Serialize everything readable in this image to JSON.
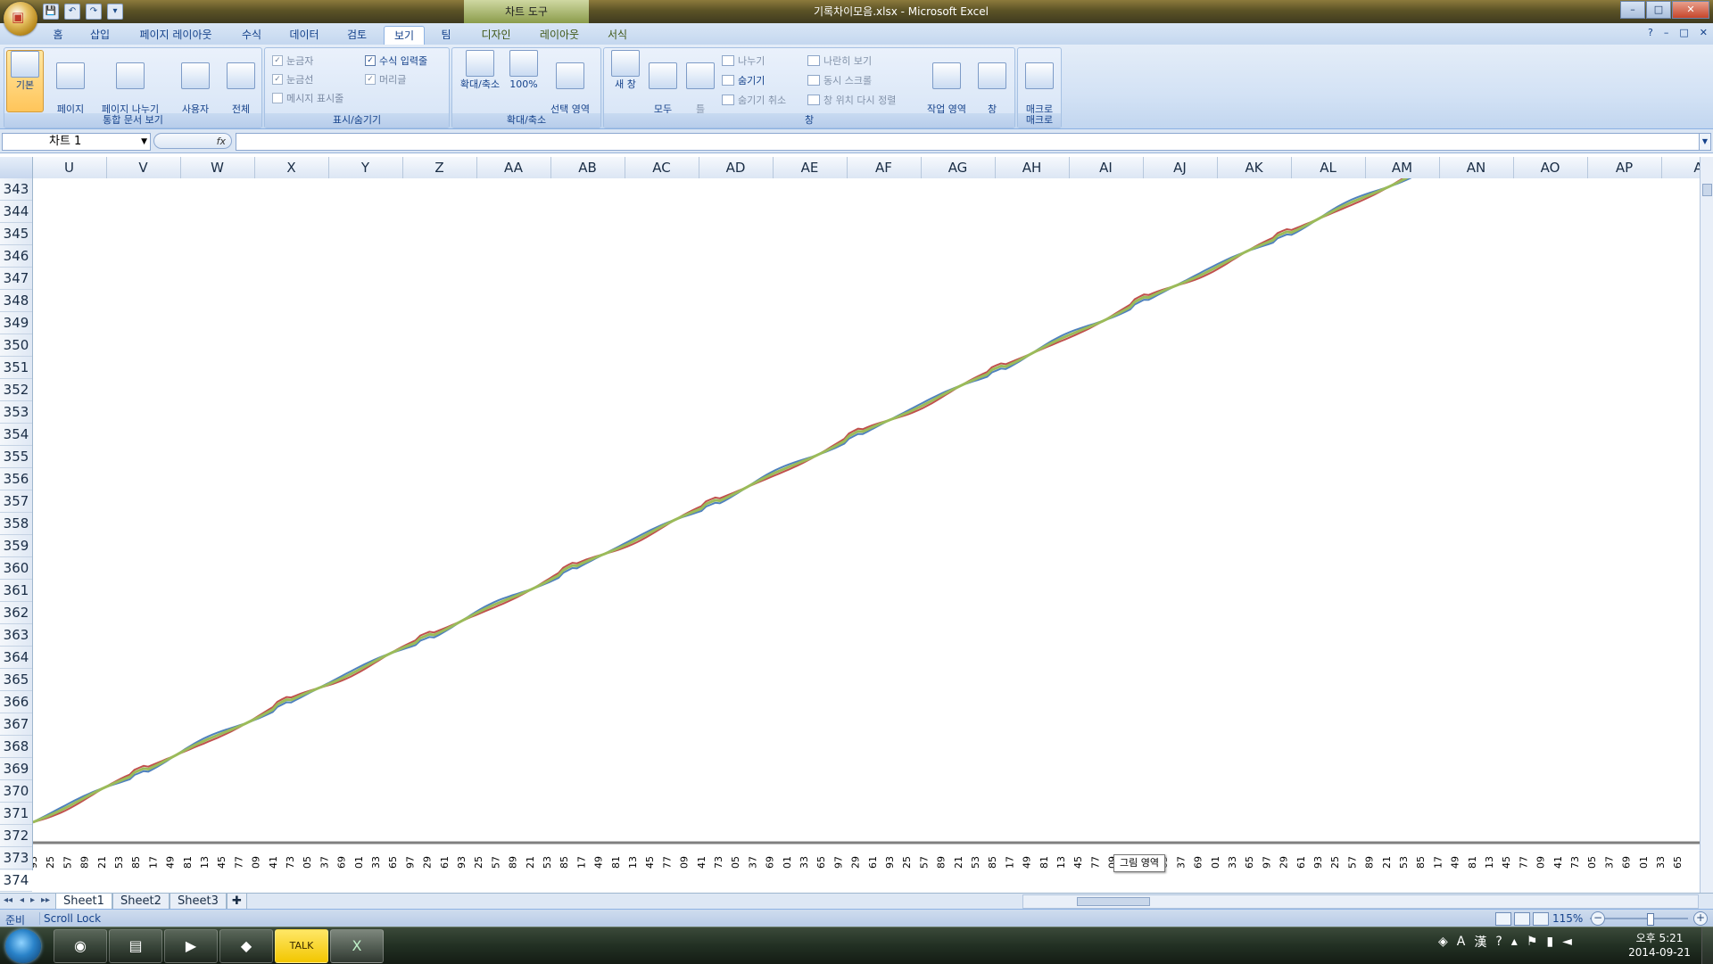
{
  "window": {
    "title": "기록차이모음.xlsx - Microsoft Excel",
    "context_tab_group": "차트 도구",
    "controls": [
      "–",
      "□",
      "✕"
    ]
  },
  "qat": {
    "save": "💾",
    "undo": "↶",
    "redo": "↷",
    "custom": "▾"
  },
  "ribbon_tabs": [
    {
      "label": "홈"
    },
    {
      "label": "삽입"
    },
    {
      "label": "페이지 레이아웃"
    },
    {
      "label": "수식"
    },
    {
      "label": "데이터"
    },
    {
      "label": "검토"
    },
    {
      "label": "보기",
      "active": true
    },
    {
      "label": "팀"
    },
    {
      "label": "디자인",
      "context": true
    },
    {
      "label": "레이아웃",
      "context": true
    },
    {
      "label": "서식",
      "context": true
    }
  ],
  "ribbon": {
    "workbook_views": {
      "label": "통합 문서 보기",
      "normal": "기본",
      "page_layout": "페이지\n레이아웃",
      "page_break": "페이지 나누기\n미리 보기",
      "custom_views": "사용자\n지정 보기",
      "full_screen": "전체\n화면"
    },
    "show_hide": {
      "label": "표시/숨기기",
      "ruler": "눈금자",
      "gridlines": "눈금선",
      "message_bar": "메시지 표시줄",
      "formula_bar": "수식 입력줄",
      "headings": "머리글"
    },
    "zoom": {
      "label": "확대/축소",
      "zoom": "확대/축소",
      "hundred": "100%",
      "zoom_selection": "선택 영역\n확대/축소"
    },
    "window": {
      "label": "창",
      "new_window": "새 창",
      "arrange_all": "모두\n정렬",
      "freeze_panes": "틀\n고정 ▾",
      "split": "나누기",
      "hide": "숨기기",
      "unhide": "숨기기 취소",
      "side_by_side": "나란히 보기",
      "sync_scroll": "동시 스크롤",
      "reset_position": "창 위치 다시 정렬",
      "save_workspace": "작업 영역\n저장",
      "switch_windows": "창\n전환 ▾"
    },
    "macros": {
      "label": "매크로",
      "macros": "매크로\n▾"
    }
  },
  "formula_bar": {
    "name_box": "차트 1",
    "fx": "fx",
    "value": ""
  },
  "columns": [
    "U",
    "V",
    "W",
    "X",
    "Y",
    "Z",
    "AA",
    "AB",
    "AC",
    "AD",
    "AE",
    "AF",
    "AG",
    "AH",
    "AI",
    "AJ",
    "AK",
    "AL",
    "AM",
    "AN",
    "AO",
    "AP",
    "A"
  ],
  "rows": [
    "343",
    "344",
    "345",
    "346",
    "347",
    "348",
    "349",
    "350",
    "351",
    "352",
    "353",
    "354",
    "355",
    "356",
    "357",
    "358",
    "359",
    "360",
    "361",
    "362",
    "363",
    "364",
    "365",
    "366",
    "367",
    "368",
    "369",
    "370",
    "371",
    "372",
    "373",
    "374"
  ],
  "chart_data": {
    "type": "line",
    "series": [
      {
        "color": "#4f81bd",
        "trend": "rising",
        "wave_offset": -1
      },
      {
        "color": "#c0504d",
        "trend": "rising",
        "wave_offset": 1
      },
      {
        "color": "#9bbb59",
        "trend": "rising",
        "wave_offset": 0
      }
    ],
    "x_tick_labels": [
      "93",
      "25",
      "57",
      "89",
      "21",
      "53",
      "85",
      "17",
      "49",
      "81",
      "13",
      "45",
      "77",
      "09",
      "41",
      "73",
      "05",
      "37",
      "69",
      "01",
      "33",
      "65",
      "97",
      "29",
      "61",
      "93",
      "25",
      "57",
      "89",
      "21",
      "53",
      "85",
      "17",
      "49",
      "81",
      "13",
      "45",
      "77",
      "09",
      "41",
      "73",
      "05",
      "37",
      "69",
      "01",
      "33",
      "65",
      "97",
      "29",
      "61",
      "93",
      "25",
      "57",
      "89",
      "21",
      "53",
      "85",
      "17",
      "49",
      "81",
      "13",
      "45",
      "77",
      "09",
      "41",
      "73",
      "05",
      "37",
      "69",
      "01",
      "33",
      "65",
      "97",
      "29",
      "61",
      "93",
      "25",
      "57",
      "89",
      "21",
      "53",
      "85",
      "17",
      "49",
      "81",
      "13",
      "45",
      "77",
      "09",
      "41",
      "73",
      "05",
      "37",
      "69",
      "01",
      "33",
      "65",
      "97",
      "29"
    ],
    "tooltip": "그림 영역",
    "grid": false
  },
  "sheets": [
    "Sheet1",
    "Sheet2",
    "Sheet3"
  ],
  "status": {
    "ready": "준비",
    "scroll_lock": "Scroll Lock",
    "zoom": "115%"
  },
  "taskbar": {
    "apps": [
      {
        "name": "chrome",
        "glyph": "◉"
      },
      {
        "name": "explorer",
        "glyph": "▤"
      },
      {
        "name": "media-player",
        "glyph": "▶"
      },
      {
        "name": "visual-studio",
        "glyph": "◆"
      },
      {
        "name": "kakaotalk",
        "glyph": "TALK"
      },
      {
        "name": "excel",
        "glyph": "X",
        "active": true
      }
    ],
    "tray": {
      "lang": "A",
      "hanja": "漢",
      "help": "?"
    },
    "clock_time": "오후 5:21",
    "clock_date": "2014-09-21"
  }
}
